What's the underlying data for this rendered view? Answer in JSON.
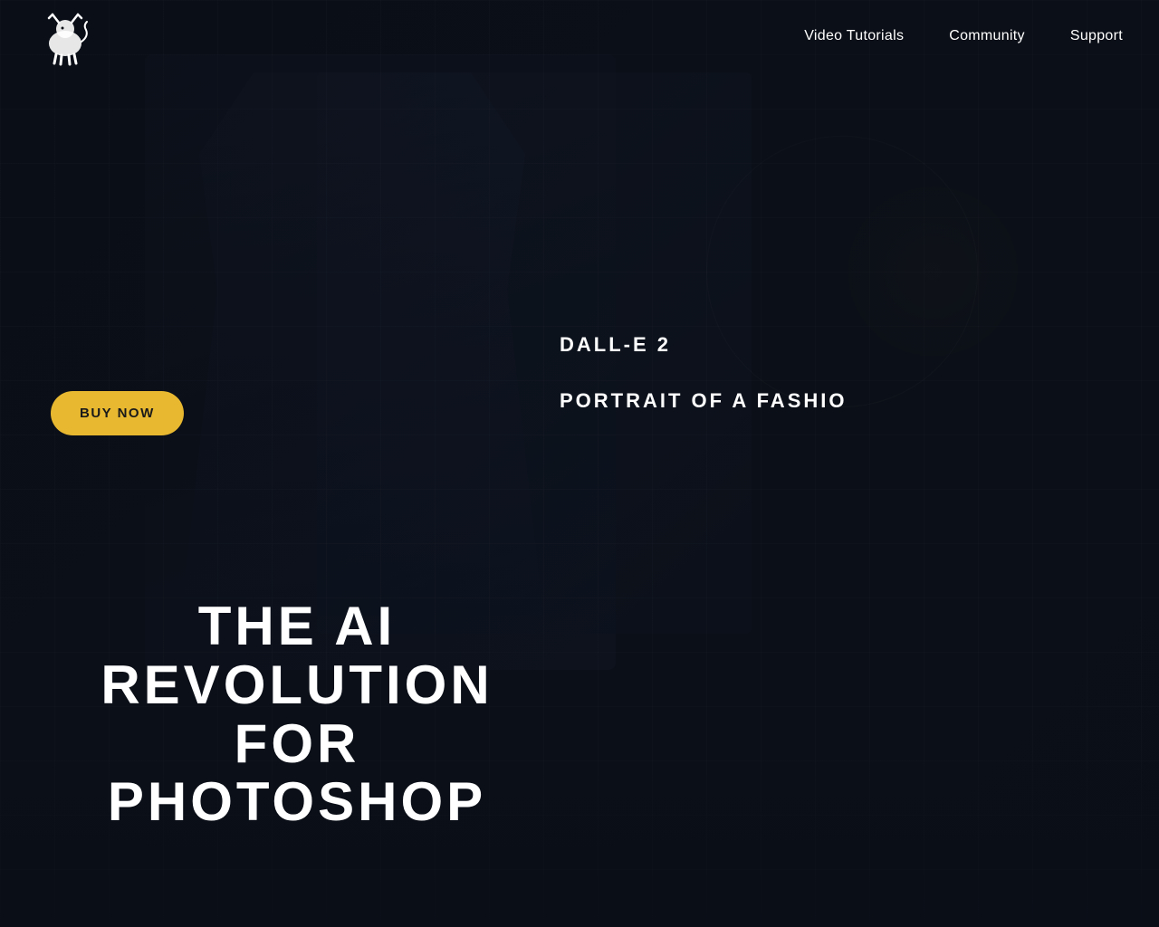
{
  "nav": {
    "links": [
      {
        "label": "Video Tutorials",
        "id": "video-tutorials"
      },
      {
        "label": "Community",
        "id": "community"
      },
      {
        "label": "Support",
        "id": "support"
      }
    ]
  },
  "hero": {
    "dalle_label": "DALL-E 2",
    "portrait_label": "PORTRAIT OF A FASHIO",
    "buy_now_label": "BUY NOW",
    "headline_line1": "THE AI REVOLUTION FOR",
    "headline_line2": "PHOTOSHOP"
  },
  "colors": {
    "background": "#0d1117",
    "accent": "#e8b830",
    "text_primary": "#ffffff",
    "text_dark": "#1a1a1a"
  }
}
